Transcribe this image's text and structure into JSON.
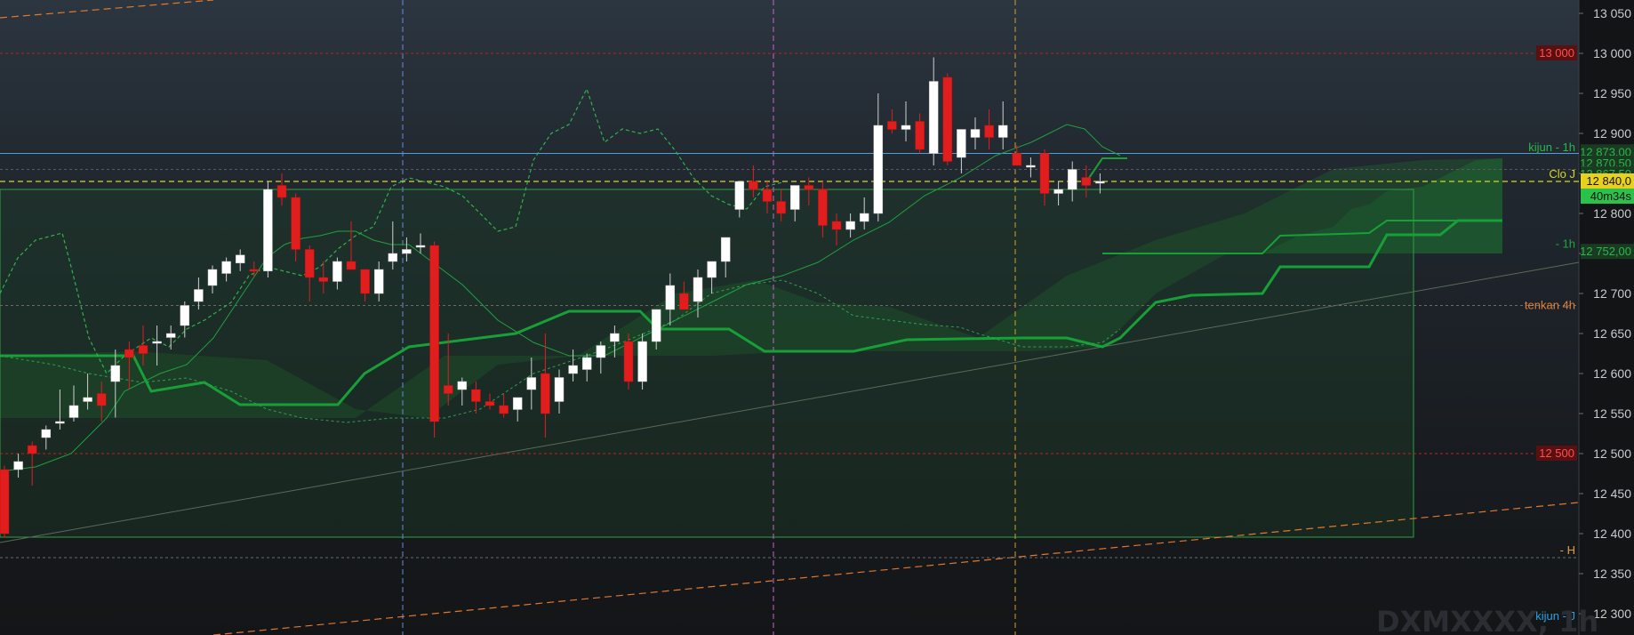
{
  "chart_data": {
    "type": "candlestick",
    "symbol": "DXMXXXX, 1h",
    "y_axis": {
      "min": 12280,
      "max": 13060,
      "ticks": [
        "13 050",
        "13 000",
        "12 950",
        "12 900",
        "12 850",
        "12 800",
        "12 750",
        "12 700",
        "12 650",
        "12 600",
        "12 550",
        "12 500",
        "12 450",
        "12 400",
        "12 350",
        "12 300"
      ]
    },
    "last_price": "12 840,0",
    "countdown": "40m34s",
    "levels": [
      {
        "name": "13 000 level",
        "value": 13000,
        "label": "13 000",
        "color": "#d42020"
      },
      {
        "name": "12 500 level",
        "value": 12500,
        "label": "12 500",
        "color": "#d42020"
      },
      {
        "name": "Clo J",
        "value": 12840,
        "label": "Clo J",
        "color": "#d8d820"
      },
      {
        "name": "kijun 1h",
        "value": 12752,
        "label": "- 1h",
        "color": "#1fa83a"
      },
      {
        "name": "kijun 4h",
        "value": 12871,
        "label": "kijun - 1h",
        "color": "#2ab84a"
      },
      {
        "name": "tenkan 4h",
        "value": 12685,
        "label": "tenkan 4h",
        "color": "#e08040"
      },
      {
        "name": "H",
        "value": 12370,
        "label": "- H",
        "color": "#e0a040"
      },
      {
        "name": "kijun J",
        "value": 12280,
        "label": "kijun - J",
        "color": "#30a0e0"
      }
    ],
    "right_tags": [
      "12 873,00",
      "12 870,50",
      "12 867,50",
      "12 752,00"
    ],
    "candles": [
      [
        12480,
        12485,
        12395,
        12400
      ],
      [
        12480,
        12500,
        12470,
        12490
      ],
      [
        12510,
        12515,
        12460,
        12500
      ],
      [
        12520,
        12535,
        12505,
        12530
      ],
      [
        12540,
        12580,
        12530,
        12540
      ],
      [
        12545,
        12585,
        12540,
        12560
      ],
      [
        12565,
        12600,
        12555,
        12570
      ],
      [
        12575,
        12590,
        12540,
        12560
      ],
      [
        12590,
        12630,
        12545,
        12610
      ],
      [
        12630,
        12640,
        12580,
        12620
      ],
      [
        12635,
        12660,
        12610,
        12625
      ],
      [
        12640,
        12660,
        12610,
        12640
      ],
      [
        12645,
        12660,
        12630,
        12650
      ],
      [
        12660,
        12690,
        12645,
        12685
      ],
      [
        12690,
        12720,
        12680,
        12705
      ],
      [
        12710,
        12735,
        12700,
        12730
      ],
      [
        12725,
        12745,
        12715,
        12740
      ],
      [
        12738,
        12755,
        12728,
        12748
      ],
      [
        12730,
        12740,
        12720,
        12728
      ],
      [
        12728,
        12840,
        12720,
        12830
      ],
      [
        12835,
        12850,
        12810,
        12820
      ],
      [
        12820,
        12825,
        12740,
        12755
      ],
      [
        12755,
        12760,
        12690,
        12720
      ],
      [
        12720,
        12740,
        12700,
        12715
      ],
      [
        12715,
        12745,
        12705,
        12740
      ],
      [
        12740,
        12790,
        12730,
        12730
      ],
      [
        12730,
        12730,
        12690,
        12700
      ],
      [
        12700,
        12740,
        12690,
        12730
      ],
      [
        12740,
        12790,
        12730,
        12750
      ],
      [
        12750,
        12770,
        12740,
        12755
      ],
      [
        12760,
        12775,
        12750,
        12760
      ],
      [
        12760,
        12765,
        12520,
        12540
      ],
      [
        12585,
        12650,
        12560,
        12575
      ],
      [
        12580,
        12595,
        12560,
        12590
      ],
      [
        12580,
        12590,
        12550,
        12565
      ],
      [
        12565,
        12575,
        12555,
        12560
      ],
      [
        12560,
        12575,
        12545,
        12550
      ],
      [
        12555,
        12570,
        12540,
        12570
      ],
      [
        12580,
        12620,
        12555,
        12595
      ],
      [
        12600,
        12650,
        12520,
        12550
      ],
      [
        12565,
        12605,
        12550,
        12595
      ],
      [
        12600,
        12630,
        12590,
        12610
      ],
      [
        12605,
        12625,
        12590,
        12620
      ],
      [
        12620,
        12640,
        12600,
        12635
      ],
      [
        12640,
        12660,
        12620,
        12650
      ],
      [
        12640,
        12650,
        12580,
        12590
      ],
      [
        12590,
        12650,
        12580,
        12640
      ],
      [
        12640,
        12670,
        12630,
        12680
      ],
      [
        12680,
        12725,
        12660,
        12710
      ],
      [
        12700,
        12715,
        12680,
        12680
      ],
      [
        12690,
        12730,
        12670,
        12720
      ],
      [
        12720,
        12740,
        12700,
        12740
      ],
      [
        12740,
        12760,
        12720,
        12770
      ],
      [
        12805,
        12840,
        12795,
        12840
      ],
      [
        12840,
        12860,
        12820,
        12830
      ],
      [
        12830,
        12840,
        12800,
        12815
      ],
      [
        12815,
        12830,
        12790,
        12800
      ],
      [
        12805,
        12830,
        12790,
        12835
      ],
      [
        12835,
        12845,
        12810,
        12830
      ],
      [
        12830,
        12840,
        12770,
        12785
      ],
      [
        12790,
        12800,
        12760,
        12780
      ],
      [
        12780,
        12800,
        12770,
        12790
      ],
      [
        12790,
        12820,
        12780,
        12800
      ],
      [
        12800,
        12950,
        12790,
        12910
      ],
      [
        12915,
        12930,
        12900,
        12905
      ],
      [
        12905,
        12940,
        12890,
        12910
      ],
      [
        12915,
        12925,
        12875,
        12880
      ],
      [
        12875,
        12995,
        12860,
        12965
      ],
      [
        12970,
        12975,
        12860,
        12865
      ],
      [
        12870,
        12900,
        12850,
        12905
      ],
      [
        12895,
        12920,
        12880,
        12905
      ],
      [
        12910,
        12930,
        12880,
        12895
      ],
      [
        12895,
        12940,
        12880,
        12910
      ],
      [
        12875,
        12885,
        12860,
        12860
      ],
      [
        12860,
        12870,
        12845,
        12860
      ],
      [
        12875,
        12880,
        12810,
        12825
      ],
      [
        12825,
        12840,
        12810,
        12830
      ],
      [
        12830,
        12865,
        12815,
        12855
      ],
      [
        12845,
        12860,
        12820,
        12835
      ],
      [
        12840,
        12850,
        12825,
        12840
      ]
    ]
  }
}
